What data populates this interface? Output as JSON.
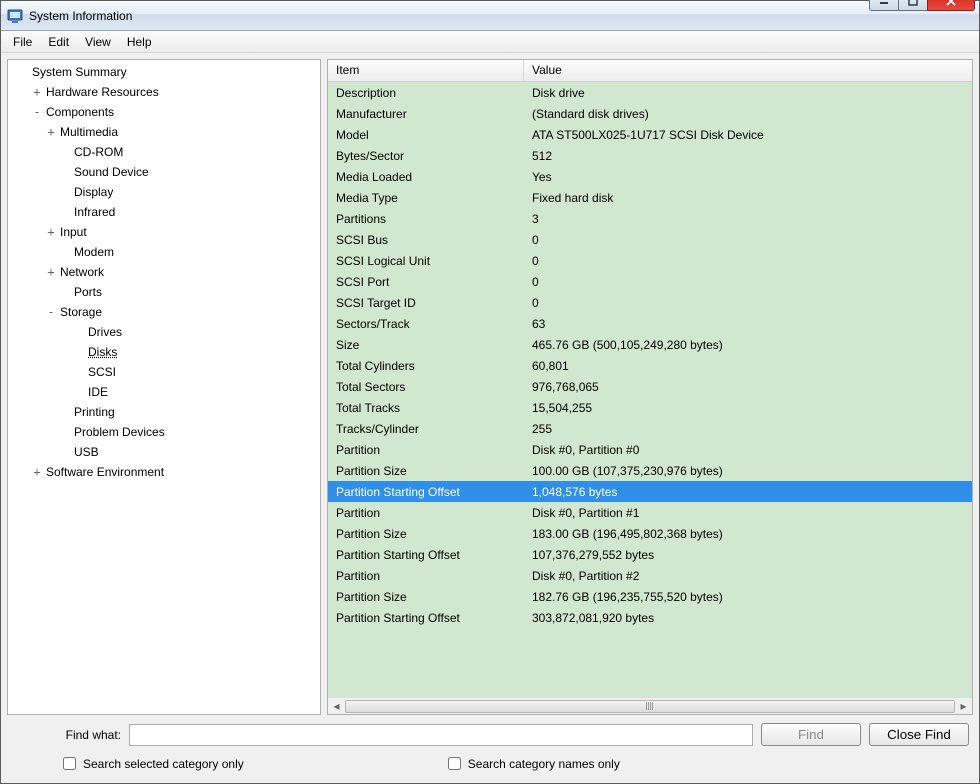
{
  "window": {
    "title": "System Information"
  },
  "menu": {
    "file": "File",
    "edit": "Edit",
    "view": "View",
    "help": "Help"
  },
  "tree": [
    {
      "indent": 0,
      "tw": "",
      "label": "System Summary"
    },
    {
      "indent": 1,
      "tw": "+",
      "label": "Hardware Resources"
    },
    {
      "indent": 1,
      "tw": "-",
      "label": "Components"
    },
    {
      "indent": 2,
      "tw": "+",
      "label": "Multimedia"
    },
    {
      "indent": 3,
      "tw": "",
      "label": "CD-ROM"
    },
    {
      "indent": 3,
      "tw": "",
      "label": "Sound Device"
    },
    {
      "indent": 3,
      "tw": "",
      "label": "Display"
    },
    {
      "indent": 3,
      "tw": "",
      "label": "Infrared"
    },
    {
      "indent": 2,
      "tw": "+",
      "label": "Input"
    },
    {
      "indent": 3,
      "tw": "",
      "label": "Modem"
    },
    {
      "indent": 2,
      "tw": "+",
      "label": "Network"
    },
    {
      "indent": 3,
      "tw": "",
      "label": "Ports"
    },
    {
      "indent": 2,
      "tw": "-",
      "label": "Storage"
    },
    {
      "indent": 4,
      "tw": "",
      "label": "Drives"
    },
    {
      "indent": 4,
      "tw": "",
      "label": "Disks",
      "selected": true
    },
    {
      "indent": 4,
      "tw": "",
      "label": "SCSI"
    },
    {
      "indent": 4,
      "tw": "",
      "label": "IDE"
    },
    {
      "indent": 3,
      "tw": "",
      "label": "Printing"
    },
    {
      "indent": 3,
      "tw": "",
      "label": "Problem Devices"
    },
    {
      "indent": 3,
      "tw": "",
      "label": "USB"
    },
    {
      "indent": 1,
      "tw": "+",
      "label": "Software Environment"
    }
  ],
  "columns": {
    "item": "Item",
    "value": "Value"
  },
  "rows": [
    {
      "item": "Description",
      "value": "Disk drive"
    },
    {
      "item": "Manufacturer",
      "value": "(Standard disk drives)"
    },
    {
      "item": "Model",
      "value": "ATA ST500LX025-1U717 SCSI Disk Device"
    },
    {
      "item": "Bytes/Sector",
      "value": "512"
    },
    {
      "item": "Media Loaded",
      "value": "Yes"
    },
    {
      "item": "Media Type",
      "value": "Fixed hard disk"
    },
    {
      "item": "Partitions",
      "value": "3"
    },
    {
      "item": "SCSI Bus",
      "value": "0"
    },
    {
      "item": "SCSI Logical Unit",
      "value": "0"
    },
    {
      "item": "SCSI Port",
      "value": "0"
    },
    {
      "item": "SCSI Target ID",
      "value": "0"
    },
    {
      "item": "Sectors/Track",
      "value": "63"
    },
    {
      "item": "Size",
      "value": "465.76 GB (500,105,249,280 bytes)"
    },
    {
      "item": "Total Cylinders",
      "value": "60,801"
    },
    {
      "item": "Total Sectors",
      "value": "976,768,065"
    },
    {
      "item": "Total Tracks",
      "value": "15,504,255"
    },
    {
      "item": "Tracks/Cylinder",
      "value": "255"
    },
    {
      "item": "Partition",
      "value": "Disk #0, Partition #0"
    },
    {
      "item": "Partition Size",
      "value": "100.00 GB (107,375,230,976 bytes)"
    },
    {
      "item": "Partition Starting Offset",
      "value": "1,048,576 bytes",
      "selected": true
    },
    {
      "item": "Partition",
      "value": "Disk #0, Partition #1"
    },
    {
      "item": "Partition Size",
      "value": "183.00 GB (196,495,802,368 bytes)"
    },
    {
      "item": "Partition Starting Offset",
      "value": "107,376,279,552 bytes"
    },
    {
      "item": "Partition",
      "value": "Disk #0, Partition #2"
    },
    {
      "item": "Partition Size",
      "value": "182.76 GB (196,235,755,520 bytes)"
    },
    {
      "item": "Partition Starting Offset",
      "value": "303,872,081,920 bytes"
    }
  ],
  "footer": {
    "find_label": "Find what:",
    "find_value": "",
    "find_btn": "Find",
    "close_btn": "Close Find",
    "chk1": "Search selected category only",
    "chk2": "Search category names only"
  }
}
